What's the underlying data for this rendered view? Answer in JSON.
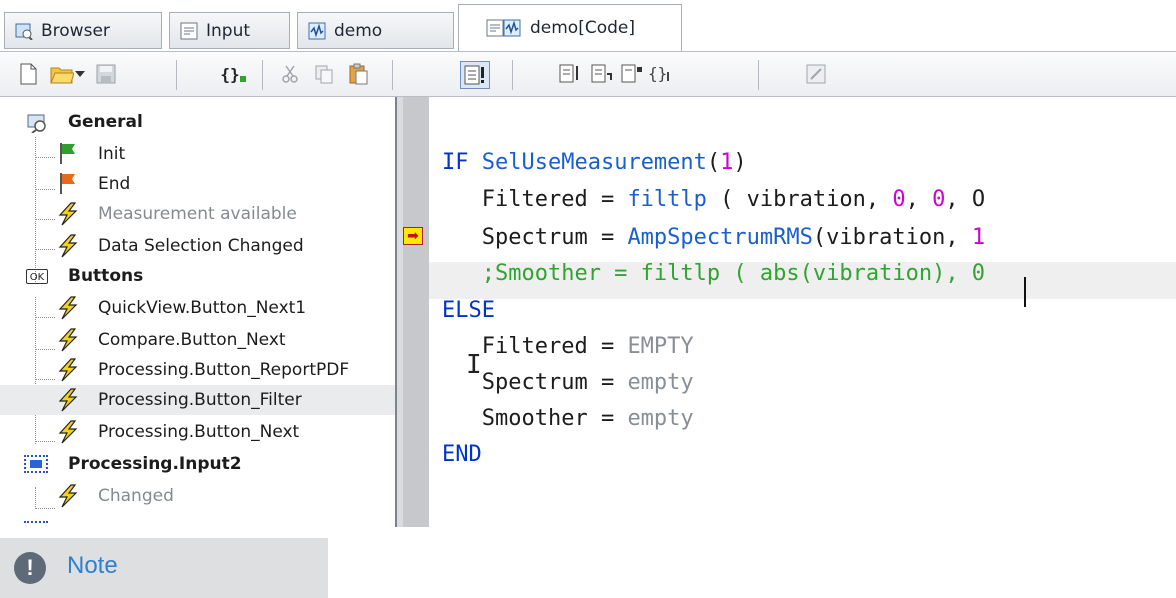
{
  "tabs": [
    {
      "label": "Browser",
      "icon": "browser-icon"
    },
    {
      "label": "Input",
      "icon": "input-icon"
    },
    {
      "label": "demo",
      "icon": "demo-icon"
    },
    {
      "label": "demo[Code]",
      "icon": "code-view-icon",
      "active": true
    }
  ],
  "toolbar": {
    "buttons": [
      "new-icon",
      "open-folder-icon",
      "dropdown-arrow-icon",
      "save-icon",
      "braces-icon",
      "cut-icon",
      "copy-icon",
      "paste-icon",
      "code-check-icon",
      "step-into-icon",
      "step-over-icon",
      "step-out-icon",
      "run-to-cursor-icon",
      "edit-icon"
    ],
    "braces_glyph": "{}"
  },
  "tree": {
    "general": {
      "label": "General",
      "children": [
        "Init",
        "End",
        "Measurement available",
        "Data Selection Changed"
      ]
    },
    "buttons": {
      "label": "Buttons",
      "children": [
        "QuickView.Button_Next1",
        "Compare.Button_Next",
        "Processing.Button_ReportPDF",
        "Processing.Button_Filter",
        "Processing.Button_Next"
      ]
    },
    "input2": {
      "label": "Processing.Input2",
      "children": [
        "Changed"
      ]
    },
    "selected": "Processing.Button_Filter",
    "ok_badge": "OK"
  },
  "code": {
    "lines": [
      [
        [
          "kw",
          "IF"
        ],
        [
          "id",
          " "
        ],
        [
          "fn",
          "SelUseMeasurement"
        ],
        [
          "id",
          "("
        ],
        [
          "num",
          "1"
        ],
        [
          "id",
          ")"
        ]
      ],
      [
        [
          "id",
          "   Filtered = "
        ],
        [
          "fn",
          "filtlp"
        ],
        [
          "id",
          " ( vibration, "
        ],
        [
          "num",
          "0"
        ],
        [
          "id",
          ", "
        ],
        [
          "num",
          "0"
        ],
        [
          "id",
          ", O"
        ]
      ],
      [
        [
          "id",
          "   Spectrum = "
        ],
        [
          "fn",
          "AmpSpectrumRMS"
        ],
        [
          "id",
          "(vibration, "
        ],
        [
          "num",
          "1"
        ]
      ],
      [
        [
          "cm",
          "   ;Smoother = filtlp ( abs(vibration), 0"
        ]
      ],
      [
        [
          "kw",
          "ELSE"
        ]
      ],
      [
        [
          "id",
          "   Filtered = "
        ],
        [
          "gr",
          "EMPTY"
        ]
      ],
      [
        [
          "id",
          "   Spectrum = "
        ],
        [
          "gr",
          "empty"
        ]
      ],
      [
        [
          "id",
          "   Smoother = "
        ],
        [
          "gr",
          "empty"
        ]
      ],
      [
        [
          "kw",
          "END"
        ]
      ]
    ],
    "execution_marker": "➡"
  },
  "note": {
    "label": "Note",
    "icon_glyph": "!"
  },
  "colors": {
    "keyword": "#0033cc",
    "function": "#1a5fd0",
    "number": "#d000d0",
    "comment": "#2fa52f",
    "note_text": "#2f80d0"
  }
}
